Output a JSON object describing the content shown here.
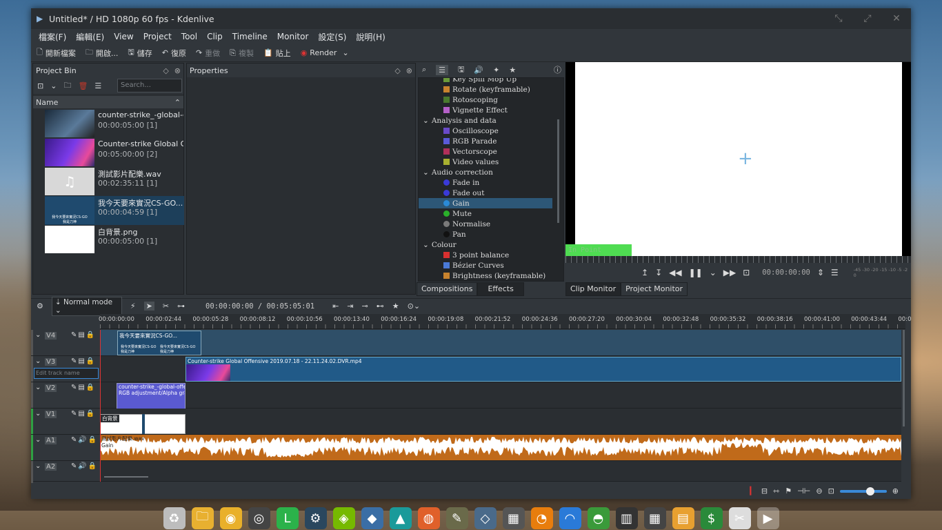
{
  "window": {
    "title": "Untitled* / HD 1080p 60 fps - Kdenlive"
  },
  "menu": [
    "檔案(F)",
    "編輯(E)",
    "View",
    "Project",
    "Tool",
    "Clip",
    "Timeline",
    "Monitor",
    "設定(S)",
    "說明(H)"
  ],
  "toolbar": [
    {
      "icon": "new-file-icon",
      "glyph": "🗋",
      "label": "開新檔案",
      "enabled": true
    },
    {
      "icon": "open-folder-icon",
      "glyph": "🗀",
      "label": "開啟...",
      "enabled": true
    },
    {
      "icon": "save-icon",
      "glyph": "🖫",
      "label": "儲存",
      "enabled": true
    },
    {
      "icon": "undo-icon",
      "glyph": "↶",
      "label": "復原",
      "enabled": true
    },
    {
      "icon": "redo-icon",
      "glyph": "↷",
      "label": "重做",
      "enabled": false
    },
    {
      "icon": "copy-icon",
      "glyph": "⎘",
      "label": "複製",
      "enabled": false
    },
    {
      "icon": "paste-icon",
      "glyph": "📋",
      "label": "貼上",
      "enabled": true
    },
    {
      "icon": "render-icon",
      "glyph": "◉",
      "label": "Render",
      "enabled": true
    }
  ],
  "project_bin": {
    "title": "Project Bin",
    "search_placeholder": "Search...",
    "column": "Name",
    "items": [
      {
        "name": "counter-strike_-global-c",
        "duration": "00:00:05:00 [1]"
      },
      {
        "name": "Counter-strike  Global O",
        "duration": "00:05:00:00 [2]"
      },
      {
        "name": "測試影片配樂.wav",
        "duration": "00:02:35:11 [1]"
      },
      {
        "name": "我今天要來實況CS-GO...",
        "duration": "00:00:04:59 [1]",
        "thumb_text": "我今天要來實況CS-GO\n我是刀神"
      },
      {
        "name": "白背景.png",
        "duration": "00:00:05:00 [1]"
      }
    ]
  },
  "properties": {
    "title": "Properties"
  },
  "effects_list": [
    {
      "label": "Key Spill Mop Up",
      "color": "#6a9a3a",
      "level": 2
    },
    {
      "label": "Rotate (keyframable)",
      "color": "#c8832e",
      "level": 2
    },
    {
      "label": "Rotoscoping",
      "color": "#4a7a2e",
      "level": 2
    },
    {
      "label": "Vignette Effect",
      "color": "#b560c8",
      "level": 2
    },
    {
      "label": "Analysis and data",
      "color": "",
      "level": 1
    },
    {
      "label": "Oscilloscope",
      "color": "#6a4ac8",
      "level": 2
    },
    {
      "label": "RGB Parade",
      "color": "#5a5ad8",
      "level": 2
    },
    {
      "label": "Vectorscope",
      "color": "#b0305a",
      "level": 2
    },
    {
      "label": "Video values",
      "color": "#a8b030",
      "level": 2
    },
    {
      "label": "Audio correction",
      "color": "",
      "level": 1
    },
    {
      "label": "Fade in",
      "color": "#3a3ad8",
      "level": 2
    },
    {
      "label": "Fade out",
      "color": "#3a3ad8",
      "level": 2
    },
    {
      "label": "Gain",
      "color": "#2a8ad8",
      "level": 2,
      "selected": true
    },
    {
      "label": "Mute",
      "color": "#2ab02a",
      "level": 2
    },
    {
      "label": "Normalise",
      "color": "#7a7a7a",
      "level": 2
    },
    {
      "label": "Pan",
      "color": "#111111",
      "level": 2
    },
    {
      "label": "Colour",
      "color": "",
      "level": 1
    },
    {
      "label": "3 point balance",
      "color": "#d83030",
      "level": 2
    },
    {
      "label": "Bézier Curves",
      "color": "#4a7ad8",
      "level": 2
    },
    {
      "label": "Brightness (keyframable)",
      "color": "#c8832e",
      "level": 2
    }
  ],
  "effects_tabs": [
    "Compositions",
    "Effects"
  ],
  "monitor": {
    "in_point": "In Point",
    "timecode": "00:00:00:00",
    "tabs": [
      "Clip Monitor",
      "Project Monitor"
    ],
    "audio_scale": "-45 -30 -20 -15 -10 -5 -2 0"
  },
  "timeline_toolbar": {
    "mode": "Normal mode",
    "timecode": "00:00:00:00 / 00:05:05:01"
  },
  "ruler": [
    "00:00:00:00",
    "00:00:02:44",
    "00:00:05:28",
    "00:00:08:12",
    "00:00:10:56",
    "00:00:13:40",
    "00:00:16:24",
    "00:00:19:08",
    "00:00:21:52",
    "00:00:24:36",
    "00:00:27:20",
    "00:00:30:04",
    "00:00:32:48",
    "00:00:35:32",
    "00:00:38:16",
    "00:00:41:00",
    "00:00:43:44",
    "00:0"
  ],
  "tracks": [
    {
      "name": "V4",
      "bar": ""
    },
    {
      "name": "V3",
      "bar": "",
      "edit_placeholder": "Edit track name"
    },
    {
      "name": "V2",
      "bar": ""
    },
    {
      "name": "V1",
      "bar": "#2ea043"
    },
    {
      "name": "A1",
      "bar": "#2ea043"
    },
    {
      "name": "A2",
      "bar": ""
    }
  ],
  "clips": {
    "v4": "我今天要來實況CS-GO...",
    "v4_sub1": "我今天要來實況CS-GO 我是刀神",
    "v4_sub2": "我今天要來實況CS-GO 我是刀神",
    "v3": "Counter-strike  Global Offensive 2019.07.18 - 22.11.24.02.DVR.mp4",
    "v2": "counter-strike_-global-offensive-l",
    "v2_effect": "RGB adjustment/Alpha gradient",
    "v1": "白背景",
    "a1": "測試影片配樂.wav",
    "a1_effect": "Gain"
  },
  "taskbar": [
    {
      "icon": "recycle-bin-icon",
      "glyph": "♻",
      "color": "#bdbdbd"
    },
    {
      "icon": "file-manager-icon",
      "glyph": "🗀",
      "color": "#e8b030"
    },
    {
      "icon": "chrome-icon",
      "glyph": "◉",
      "color": "#e9b02a"
    },
    {
      "icon": "record-icon",
      "glyph": "◎",
      "color": "#444"
    },
    {
      "icon": "line-icon",
      "glyph": "L",
      "color": "#2bb24a"
    },
    {
      "icon": "steam-icon",
      "glyph": "⚙",
      "color": "#2a475e"
    },
    {
      "icon": "nvidia-icon",
      "glyph": "◈",
      "color": "#76b900"
    },
    {
      "icon": "virtualbox-icon",
      "glyph": "◆",
      "color": "#3a6ea5"
    },
    {
      "icon": "inkscape-icon",
      "glyph": "▲",
      "color": "#1a9a9a"
    },
    {
      "icon": "firefox-icon",
      "glyph": "◍",
      "color": "#e0602a"
    },
    {
      "icon": "gimp-icon",
      "glyph": "✎",
      "color": "#6a6a4a"
    },
    {
      "icon": "deluge-icon",
      "glyph": "◇",
      "color": "#4a6a8a"
    },
    {
      "icon": "filmstrip-icon",
      "glyph": "▦",
      "color": "#555"
    },
    {
      "icon": "blender-icon",
      "glyph": "◔",
      "color": "#e87d0d"
    },
    {
      "icon": "headphones-icon",
      "glyph": "◠",
      "color": "#2a7ad8"
    },
    {
      "icon": "audio-app-icon",
      "glyph": "◓",
      "color": "#3a9a3a"
    },
    {
      "icon": "piano-icon",
      "glyph": "▥",
      "color": "#333"
    },
    {
      "icon": "calculator-icon",
      "glyph": "▦",
      "color": "#444"
    },
    {
      "icon": "notes-icon",
      "glyph": "▤",
      "color": "#e8a030"
    },
    {
      "icon": "money-icon",
      "glyph": "$",
      "color": "#2a8a3a"
    },
    {
      "icon": "tools-icon",
      "glyph": "✂",
      "color": "#ddd"
    },
    {
      "icon": "kdenlive-icon",
      "glyph": "▶",
      "color": "#3a7ad8",
      "active": true
    }
  ]
}
